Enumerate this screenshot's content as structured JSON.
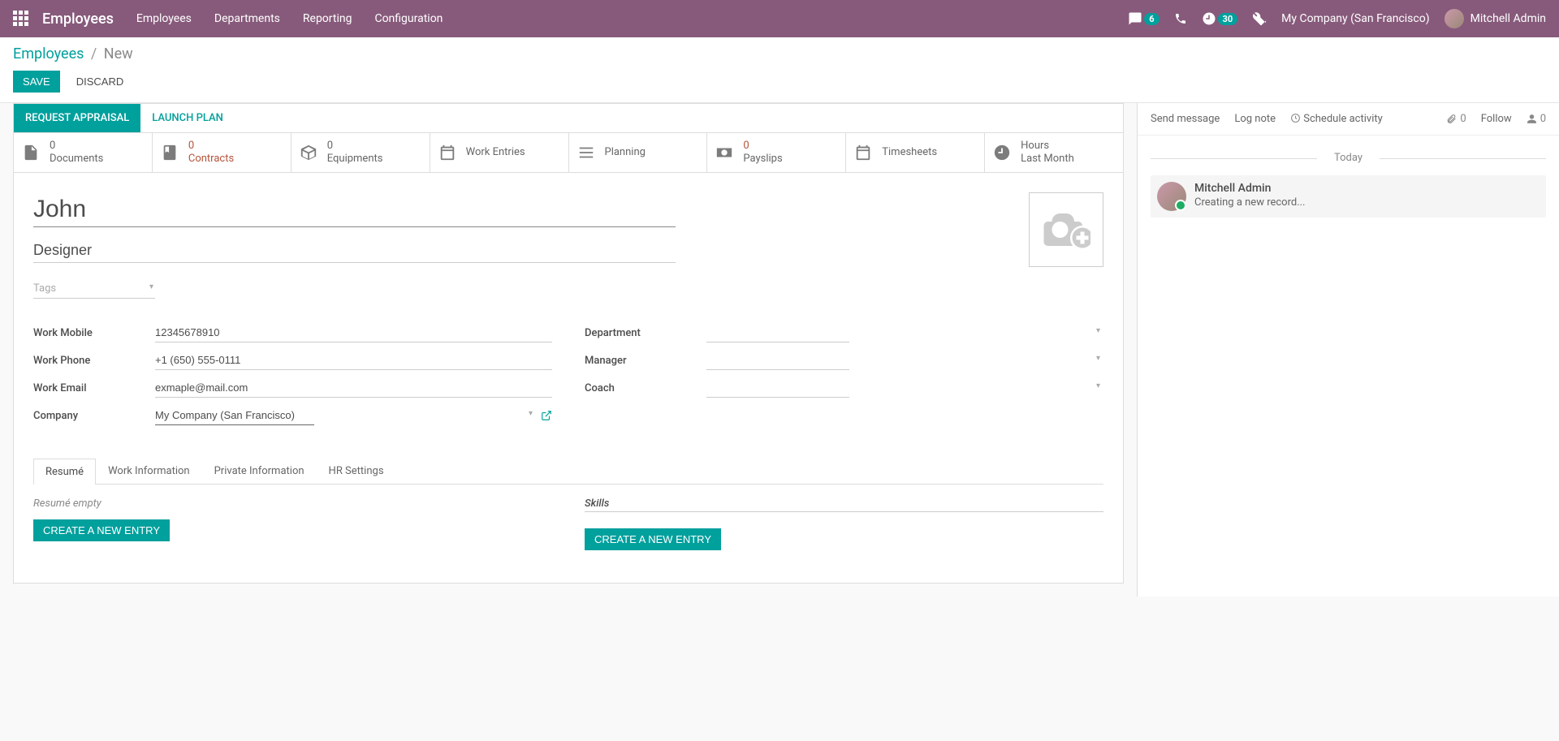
{
  "topnav": {
    "brand": "Employees",
    "menu": [
      "Employees",
      "Departments",
      "Reporting",
      "Configuration"
    ],
    "messages_badge": "6",
    "activities_badge": "30",
    "company": "My Company (San Francisco)",
    "user": "Mitchell Admin"
  },
  "breadcrumb": {
    "root": "Employees",
    "current": "New"
  },
  "buttons": {
    "save": "SAVE",
    "discard": "DISCARD"
  },
  "statusbar": {
    "request_appraisal": "REQUEST APPRAISAL",
    "launch_plan": "LAUNCH PLAN"
  },
  "statbtns": {
    "documents": {
      "val": "0",
      "lbl": "Documents"
    },
    "contracts": {
      "val": "0",
      "lbl": "Contracts"
    },
    "equipments": {
      "val": "0",
      "lbl": "Equipments"
    },
    "work_entries": {
      "lbl": "Work Entries"
    },
    "planning": {
      "lbl": "Planning"
    },
    "payslips": {
      "val": "0",
      "lbl": "Payslips"
    },
    "timesheets": {
      "lbl": "Timesheets"
    },
    "last_month": {
      "val": "Hours",
      "lbl": "Last Month"
    }
  },
  "form": {
    "name": "John",
    "job_title": "Designer",
    "tags_placeholder": "Tags",
    "labels": {
      "work_mobile": "Work Mobile",
      "work_phone": "Work Phone",
      "work_email": "Work Email",
      "company": "Company",
      "department": "Department",
      "manager": "Manager",
      "coach": "Coach"
    },
    "values": {
      "work_mobile": "12345678910",
      "work_phone": "+1 (650) 555-0111",
      "work_email": "exmaple@mail.com",
      "company": "My Company (San Francisco)",
      "department": "",
      "manager": "",
      "coach": ""
    }
  },
  "tabs": [
    "Resumé",
    "Work Information",
    "Private Information",
    "HR Settings"
  ],
  "resume": {
    "empty": "Resumé empty",
    "create": "CREATE A NEW ENTRY",
    "skills_label": "Skills",
    "skills_create": "CREATE A NEW ENTRY"
  },
  "chatter": {
    "send": "Send message",
    "log": "Log note",
    "schedule": "Schedule activity",
    "attachments": "0",
    "follow": "Follow",
    "followers": "0",
    "today": "Today",
    "msg_author": "Mitchell Admin",
    "msg_text": "Creating a new record..."
  }
}
